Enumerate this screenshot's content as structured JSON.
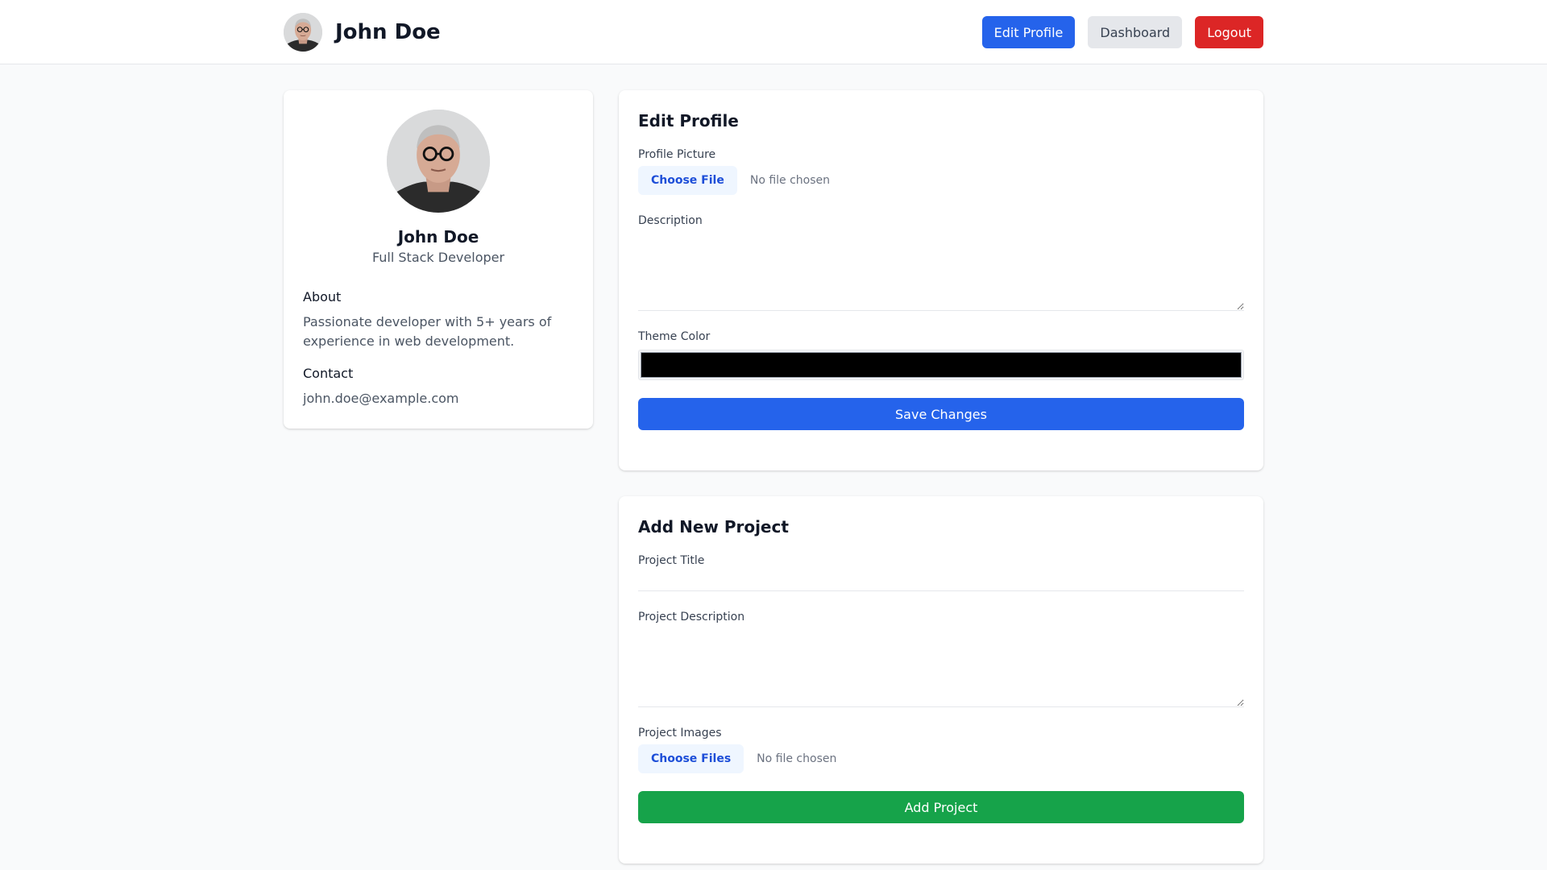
{
  "header": {
    "user_name": "John Doe",
    "nav": {
      "edit_profile": "Edit Profile",
      "dashboard": "Dashboard",
      "logout": "Logout"
    }
  },
  "profile": {
    "name": "John Doe",
    "title": "Full Stack Developer",
    "about_heading": "About",
    "about_text": "Passionate developer with 5+ years of experience in web development.",
    "contact_heading": "Contact",
    "email": "john.doe@example.com"
  },
  "edit_profile": {
    "heading": "Edit Profile",
    "picture_label": "Profile Picture",
    "choose_file": "Choose File",
    "no_file": "No file chosen",
    "description_label": "Description",
    "description_value": "",
    "theme_color_label": "Theme Color",
    "theme_color_value": "#000000",
    "save_button": "Save Changes"
  },
  "add_project": {
    "heading": "Add New Project",
    "title_label": "Project Title",
    "title_value": "",
    "description_label": "Project Description",
    "description_value": "",
    "images_label": "Project Images",
    "choose_files": "Choose Files",
    "no_file": "No file chosen",
    "add_button": "Add Project"
  },
  "colors": {
    "primary": "#2563eb",
    "danger": "#dc2626",
    "success": "#16a34a",
    "neutral_button": "#e5e7eb",
    "page_background": "#f9fafb"
  },
  "icons": {
    "header_avatar": "user-portrait",
    "profile_avatar": "user-portrait"
  }
}
